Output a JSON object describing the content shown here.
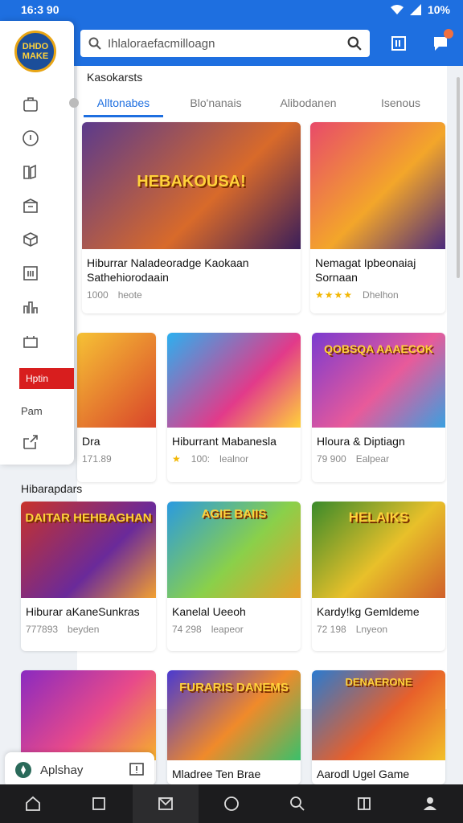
{
  "status": {
    "time": "16:3 90",
    "battery": "10%"
  },
  "search": {
    "placeholder": "Ihlaloraefacmilloagn"
  },
  "section": {
    "title": "Kasokarsts"
  },
  "tabs": [
    {
      "label": "Alltonabes"
    },
    {
      "label": "Blo'nanais"
    },
    {
      "label": "Alibodanen"
    },
    {
      "label": "Isenous"
    }
  ],
  "featured": [
    {
      "banner": "HEBAKOUSA!",
      "title": "Hiburrar Naladeoradge Kaokaan Sathehiorodaain",
      "meta1": "1000",
      "meta2": "heote"
    },
    {
      "banner": "",
      "title": "Nemagat Ipbeonaiaj Sornaan",
      "meta1": "★★★★",
      "meta2": "Dhelhon"
    }
  ],
  "row2": [
    {
      "banner": "",
      "title": "Dra",
      "meta1": "171.89",
      "meta2": ""
    },
    {
      "banner": "",
      "title": "Hiburrant Mabanesla",
      "meta1": "100:",
      "meta2": "lealnor"
    },
    {
      "banner": "QOBSQA AAAECOK",
      "title": "Hloura & Diptiagn",
      "meta1": "79 900",
      "meta2": "Ealpear"
    }
  ],
  "recent": {
    "title": "Hibarapdars"
  },
  "row3": [
    {
      "banner": "DAITAR HEHBAGHAN",
      "title": "Hiburar aKaneSunkras",
      "meta1": "777893",
      "meta2": "beyden"
    },
    {
      "banner": "AGIE BAIIS",
      "title": "Kanelal Ueeoh",
      "meta1": "74 298",
      "meta2": "leapeor"
    },
    {
      "banner": "HELAIKS",
      "title": "Kardy!kg Gemldeme",
      "meta1": "72 198",
      "meta2": "Lnyeon"
    }
  ],
  "row4": [
    {
      "banner": "",
      "title": ""
    },
    {
      "banner": "FURARIS DANEMS",
      "title": "Mladree Ten Brae"
    },
    {
      "banner": "DENAERONE",
      "title": "Aarodl Ugel Game"
    }
  ],
  "drawer": {
    "logo": "DHDO MAKE",
    "red_item": "Hptin",
    "label": "Pam"
  },
  "bottom_search": {
    "label": "Aplshay"
  },
  "colors": {
    "accent": "#1e6fe0",
    "red": "#d81e1e",
    "star": "#f2b705"
  }
}
